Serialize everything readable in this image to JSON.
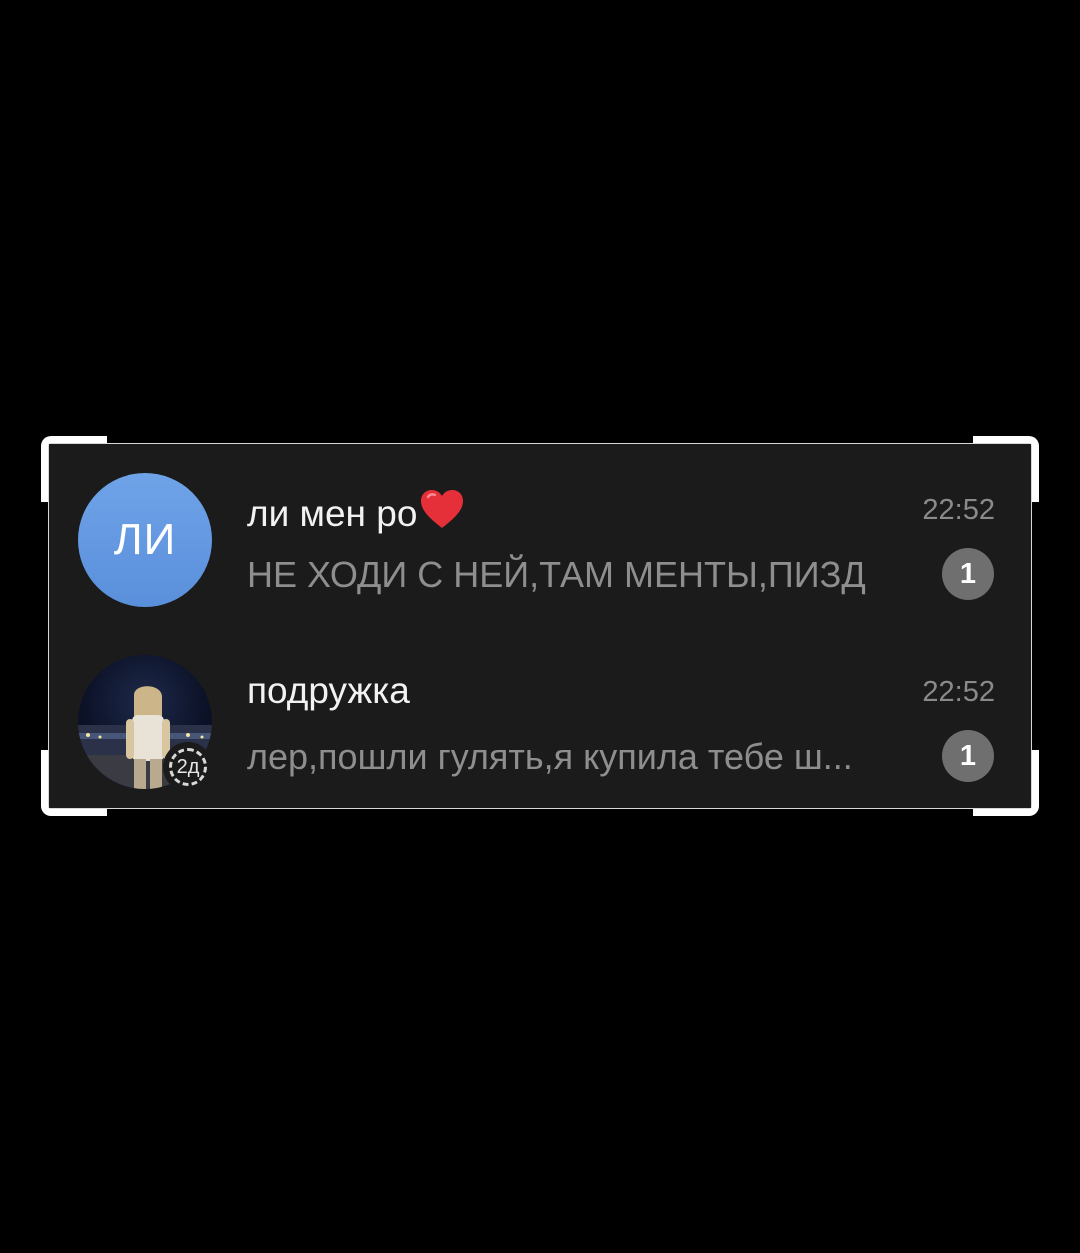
{
  "chats": [
    {
      "avatar_initials": "ЛИ",
      "avatar_color": "#6aa0e6",
      "name": "ли мен ро",
      "name_emoji": "heart",
      "time": "22:52",
      "preview": "НЕ ХОДИ С НЕЙ,ТАМ МЕНТЫ,ПИЗД",
      "unread_count": "1"
    },
    {
      "avatar_image": "person-photo",
      "story_label": "2д",
      "name": "подружка",
      "time": "22:52",
      "preview": "лер,пошли гулять,я купила тебе ш...",
      "unread_count": "1"
    }
  ],
  "colors": {
    "background": "#000000",
    "panel": "#1b1b1b",
    "badge": "#6f6f6f",
    "heart": "#e5303a"
  }
}
